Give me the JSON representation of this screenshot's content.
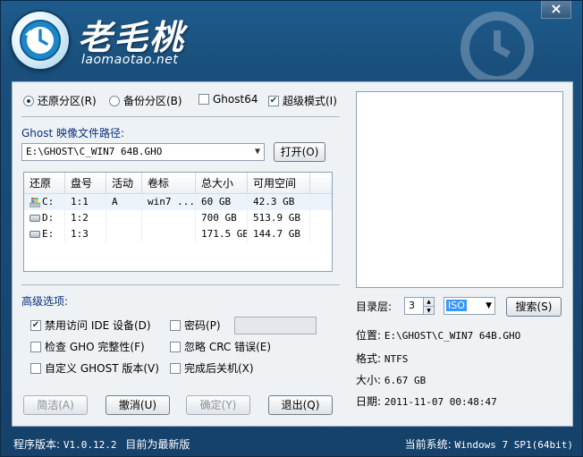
{
  "app": {
    "logo_text": "老毛桃",
    "logo_url": "laomaotao.net",
    "close_label": "×"
  },
  "mode": {
    "restore_label": "还原分区(R)",
    "restore_checked": true,
    "backup_label": "备份分区(B)",
    "backup_checked": false,
    "ghost64_label": "Ghost64",
    "ghost64_checked": false,
    "super_label": "超级模式(I)",
    "super_checked": true
  },
  "image_path": {
    "label": "Ghost 映像文件路径:",
    "value": "E:\\GHOST\\C_WIN7 64B.GHO",
    "open_button": "打开(O)"
  },
  "partition_table": {
    "headers": [
      "还原",
      "盘号",
      "活动",
      "卷标",
      "总大小",
      "可用空间"
    ],
    "rows": [
      {
        "drive": "C:",
        "disk": "1:1",
        "active": "A",
        "label": "win7 ...",
        "total": "60 GB",
        "free": "42.3 GB",
        "icon": "windows-icon"
      },
      {
        "drive": "D:",
        "disk": "1:2",
        "active": "",
        "label": "",
        "total": "700 GB",
        "free": "513.9 GB",
        "icon": "disk-icon"
      },
      {
        "drive": "E:",
        "disk": "1:3",
        "active": "",
        "label": "",
        "total": "171.5 GB",
        "free": "144.7 GB",
        "icon": "disk-icon"
      }
    ]
  },
  "advanced": {
    "title": "高级选项:",
    "disable_ide_label": "禁用访问 IDE 设备(D)",
    "disable_ide_checked": true,
    "password_label": "密码(P)",
    "password_checked": false,
    "check_gho_label": "检查 GHO 完整性(F)",
    "check_gho_checked": false,
    "ignore_crc_label": "忽略 CRC 错误(E)",
    "ignore_crc_checked": false,
    "custom_ghost_label": "自定义 GHOST 版本(V)",
    "custom_ghost_checked": false,
    "shutdown_label": "完成后关机(X)",
    "shutdown_checked": false
  },
  "buttons": {
    "clean": "简洁(A)",
    "undo": "撤消(U)",
    "confirm": "确定(Y)",
    "exit": "退出(Q)"
  },
  "search": {
    "depth_label": "目录层:",
    "depth_value": "3",
    "type_value": "ISO",
    "search_button": "搜索(S)"
  },
  "file_info": {
    "location_label": "位置:",
    "location_value": "E:\\GHOST\\C_WIN7 64B.GHO",
    "format_label": "格式:",
    "format_value": "NTFS",
    "size_label": "大小:",
    "size_value": "6.67 GB",
    "date_label": "日期:",
    "date_value": "2011-11-07   00:48:47"
  },
  "status_bar": {
    "version_label": "程序版本:",
    "version_value": "V1.0.12.2",
    "version_note": "目前为最新版",
    "system_label": "当前系统:",
    "system_value": "Windows 7 SP1(64bit)"
  }
}
